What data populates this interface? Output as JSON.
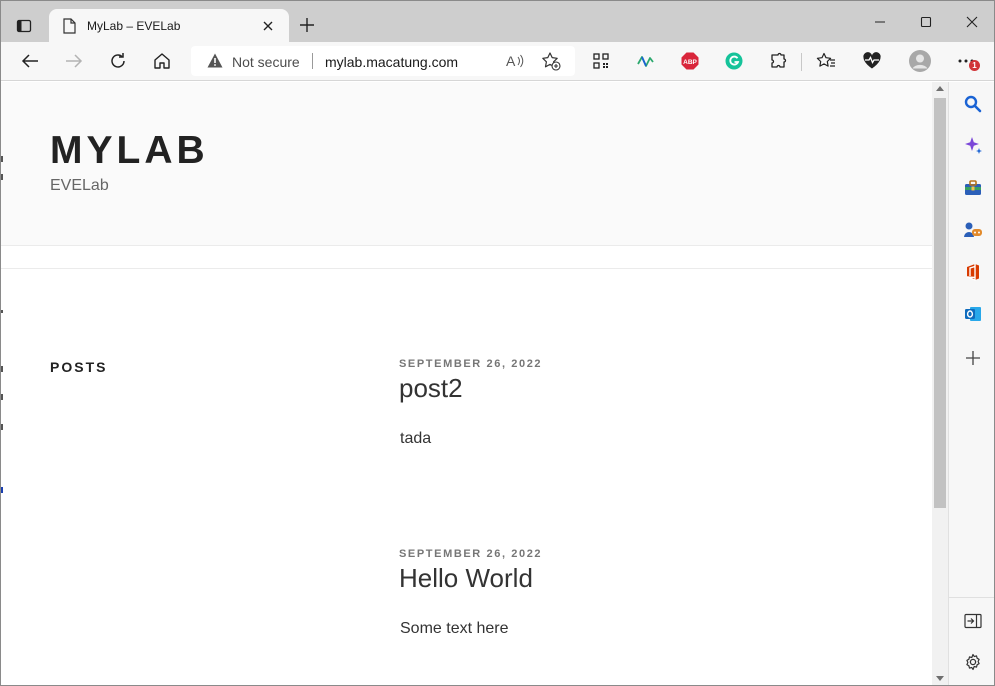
{
  "browser": {
    "tab_title": "MyLab – EVELab",
    "address": {
      "security_label": "Not secure",
      "url": "mylab.macatung.com"
    },
    "notification_count": "1",
    "colors": {
      "abp": "#d9263b",
      "grammarly": "#15c39a",
      "copilot": "#7b47d8",
      "office": "#d83b01",
      "outlook": "#0f6cbd",
      "search": "#1a63d4"
    }
  },
  "site": {
    "title": "MYLAB",
    "description": "EVELab",
    "posts_heading": "POSTS",
    "posts": [
      {
        "date": "SEPTEMBER 26, 2022",
        "title": "post2",
        "body": "tada"
      },
      {
        "date": "SEPTEMBER 26, 2022",
        "title": "Hello World",
        "body": "Some text here"
      }
    ]
  }
}
